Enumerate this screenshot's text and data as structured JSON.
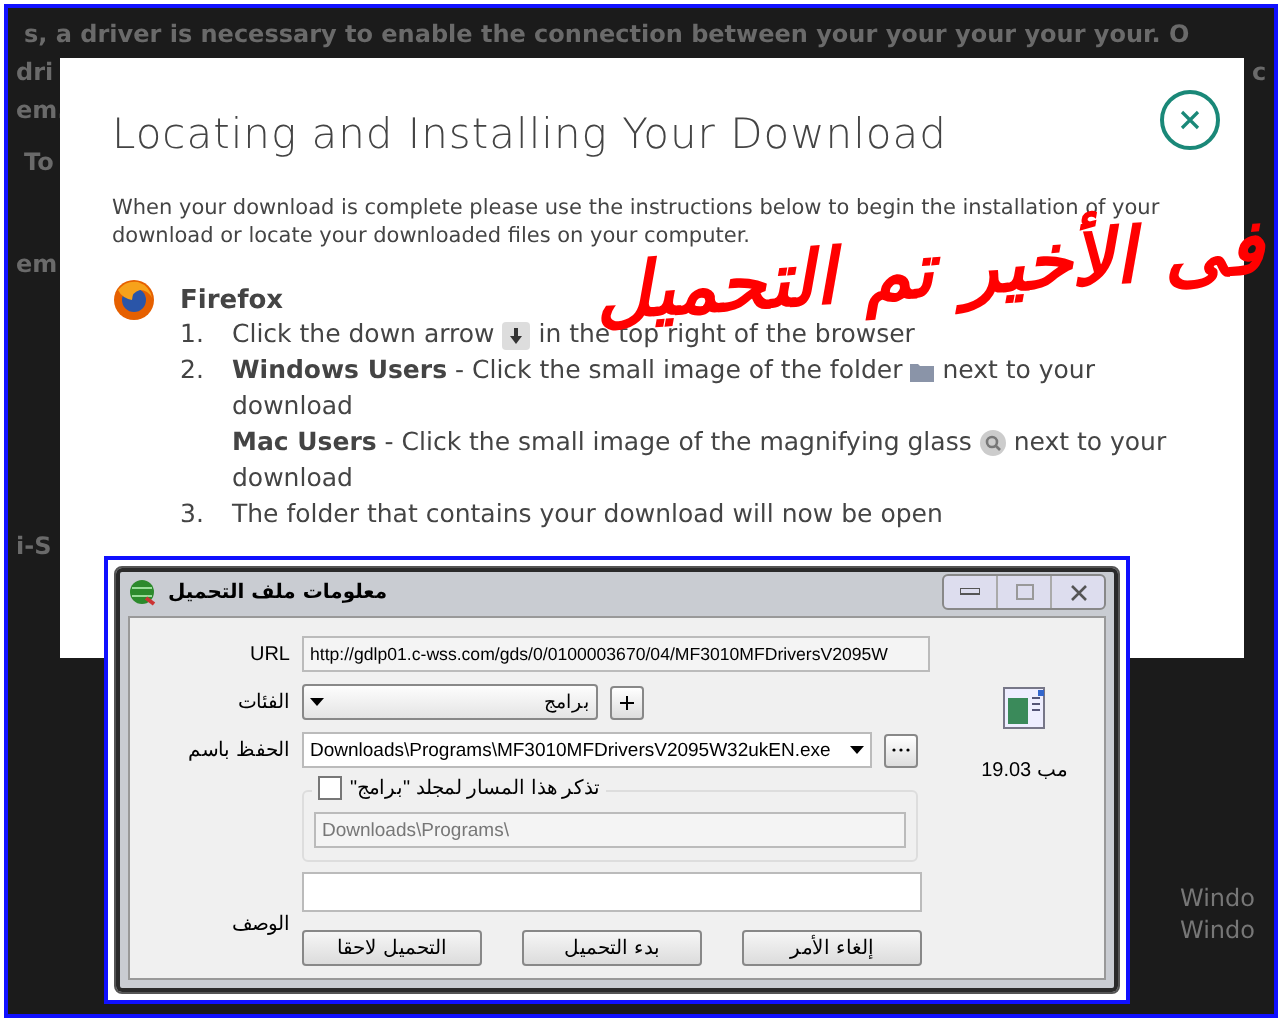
{
  "background_page": {
    "fragments": [
      "s, a driver is necessary to enable the connection between your your your your your. O",
      "dri",
      "em.",
      "To",
      "em",
      "i-S",
      "c",
      "Windo",
      "Windo"
    ]
  },
  "modal": {
    "title": "Locating and Installing Your Download",
    "intro": "When your download is complete please use the instructions below to begin the installation of your download or locate your downloaded files on your computer.",
    "browser": "Firefox",
    "steps": [
      {
        "number": "1.",
        "paragraphs": [
          {
            "before": "Click the down arrow",
            "icon": true,
            "after": "in the top right of the browser"
          }
        ]
      },
      {
        "number": "2.",
        "paragraphs": [
          {
            "before": "**Windows Users** - Click the small image of the folder",
            "icon": true,
            "after": "next to your download"
          },
          {
            "before": "**Mac Users** - Click the small image of the magnifying glass",
            "icon": true,
            "after": "next to your download"
          }
        ]
      },
      {
        "number": "3.",
        "paragraphs": [
          {
            "before": "The folder that contains your download will now be open"
          }
        ]
      }
    ]
  },
  "annotation": {
    "text": "فى الأخير تم التحميل"
  },
  "dialog": {
    "title": "معلومات ملف التحميل",
    "url_label": "URL",
    "url": "http://gdlp01.c-wss.com/gds/0/0100003670/04/MF3010MFDriversV2095W",
    "category_label": "الفئات",
    "category": "برامج",
    "save_label": "الحفظ باسم",
    "save_path": "Downloads\\Programs\\MF3010MFDriversV2095W32ukEN.exe",
    "remember_label": "تذكر هذا المسار لمجلد \"برامج\"",
    "remember_checked": false,
    "folder_path": "Downloads\\Programs\\",
    "description_label": "الوصف",
    "size": "مب 19.03",
    "buttons": [
      "إلغاء الأمر",
      "بدء التحميل",
      "التحميل لاحقا"
    ]
  }
}
